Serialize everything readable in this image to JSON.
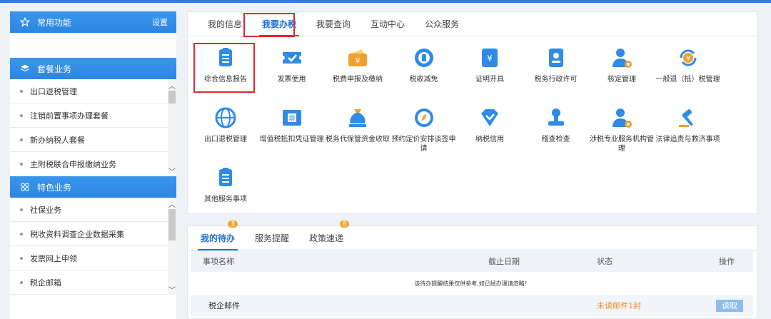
{
  "left": {
    "common": {
      "title": "常用功能",
      "setting": "设置"
    },
    "package": {
      "title": "套餐业务",
      "items": [
        "出口退税管理",
        "注销前置事项办理套餐",
        "新办纳税人套餐",
        "主附税联合申报缴纳业务"
      ]
    },
    "special": {
      "title": "特色业务",
      "items": [
        "社保业务",
        "税收资料调查企业数据采集",
        "发票网上申领",
        "税企邮箱"
      ]
    }
  },
  "tabs": [
    "我的信息",
    "我要办税",
    "我要查询",
    "互动中心",
    "公众服务"
  ],
  "services": [
    {
      "label": "综合信息报告",
      "icon": "clipboard-icon",
      "color": "#2f8be6"
    },
    {
      "label": "发票使用",
      "icon": "ticket-icon",
      "color": "#2f8be6"
    },
    {
      "label": "税费申报及缴纳",
      "icon": "wallet-yen-icon",
      "color": "#f0a030"
    },
    {
      "label": "税收减免",
      "icon": "coin-icon",
      "color": "#2f8be6"
    },
    {
      "label": "证明开具",
      "icon": "certificate-icon",
      "color": "#2f8be6"
    },
    {
      "label": "税务行政许可",
      "icon": "id-card-icon",
      "color": "#2f8be6"
    },
    {
      "label": "核定管理",
      "icon": "user-gear-icon",
      "color": "#2f8be6"
    },
    {
      "label": "一般退（抵）税管理",
      "icon": "refund-icon",
      "color": "#f0a030"
    },
    {
      "label": "出口退税管理",
      "icon": "globe-icon",
      "color": "#2f8be6"
    },
    {
      "label": "增值税抵扣凭证管理",
      "icon": "invoice-icon",
      "color": "#2f8be6"
    },
    {
      "label": "税务代保管资金收取",
      "icon": "money-bag-icon",
      "color": "#2f8be6"
    },
    {
      "label": "预约定价安排谈签申请",
      "icon": "compass-icon",
      "color": "#2f8be6"
    },
    {
      "label": "纳税信用",
      "icon": "diamond-icon",
      "color": "#2f8be6"
    },
    {
      "label": "稽查检查",
      "icon": "stamp-icon",
      "color": "#2f8be6"
    },
    {
      "label": "涉税专业服务机构管理",
      "icon": "user-gear-icon",
      "color": "#2f8be6"
    },
    {
      "label": "法律追责与救济事项",
      "icon": "gavel-icon",
      "color": "#2f8be6"
    },
    {
      "label": "其他服务事项",
      "icon": "clipboard-icon",
      "color": "#2f8be6"
    }
  ],
  "todo": {
    "tabs": [
      "我的待办",
      "服务提醒",
      "政策速递"
    ],
    "badges": [
      "1",
      "8"
    ],
    "headers": [
      "事项名称",
      "截止日期",
      "状态",
      "操作"
    ],
    "notice": "该待办提醒结果仅供参考,如已经办理请忽略！",
    "row": {
      "name": "税企邮件",
      "status": "未读邮件1封",
      "action": "读取"
    }
  }
}
